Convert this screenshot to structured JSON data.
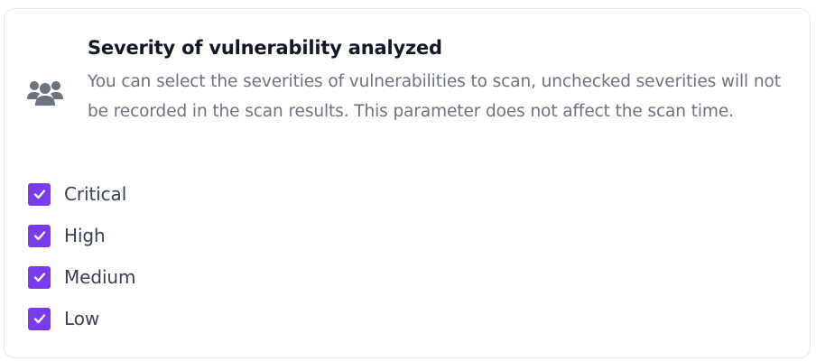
{
  "section": {
    "title": "Severity of vulnerability analyzed",
    "description": "You can select the severities of vulnerabilities to scan, unchecked severities will not be recorded in the scan results. This parameter does not affect the scan time.",
    "icon": "users-icon"
  },
  "colors": {
    "checkbox_fill": "#7c3aed",
    "title_text": "#111827",
    "description_text": "#6b7280",
    "icon_color": "#6b7280"
  },
  "options": [
    {
      "label": "Critical",
      "checked": true
    },
    {
      "label": "High",
      "checked": true
    },
    {
      "label": "Medium",
      "checked": true
    },
    {
      "label": "Low",
      "checked": true
    }
  ]
}
